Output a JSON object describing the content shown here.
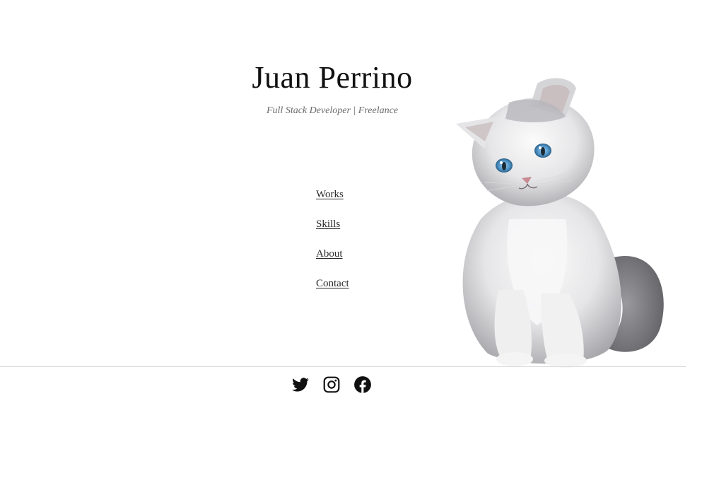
{
  "header": {
    "name": "Juan Perrino",
    "tagline": "Full Stack Developer | Freelance"
  },
  "nav": {
    "items": [
      {
        "label": "Works"
      },
      {
        "label": "Skills"
      },
      {
        "label": "About"
      },
      {
        "label": "Contact"
      }
    ]
  },
  "hero_image": {
    "icon": "kitten-illustration",
    "fur_color": "#e9e9ea",
    "eye_color": "#4a8fc4"
  },
  "footer": {
    "social": [
      {
        "icon": "twitter-icon"
      },
      {
        "icon": "instagram-icon"
      },
      {
        "icon": "facebook-icon"
      }
    ]
  }
}
